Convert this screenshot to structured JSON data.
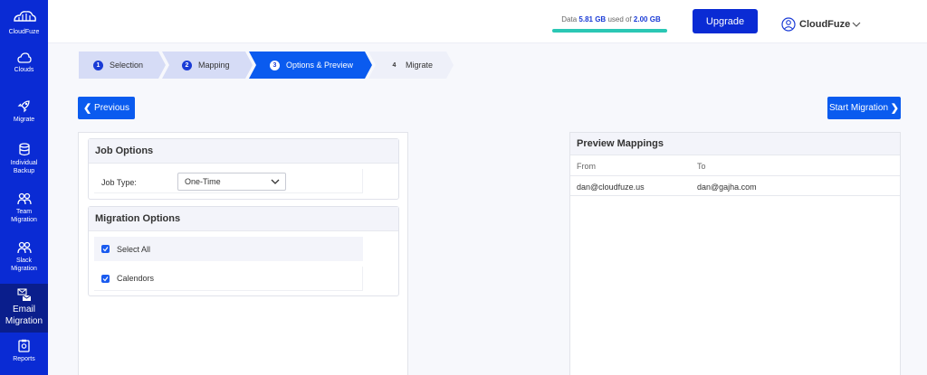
{
  "brand": {
    "name": "CloudFuze",
    "primary": "#0a2bd4",
    "active_nav": "#0a1e8c",
    "accent": "#0a5bef",
    "storage_fill": "#2ac7b4"
  },
  "sidebar": {
    "items": [
      {
        "label": "Clouds",
        "icon": "cloud-icon"
      },
      {
        "label": "Migrate",
        "icon": "rocket-icon"
      },
      {
        "label_line1": "Individual",
        "label_line2": "Backup",
        "icon": "database-icon"
      },
      {
        "label_line1": "Team",
        "label_line2": "Migration",
        "icon": "team-icon"
      },
      {
        "label_line1": "Slack",
        "label_line2": "Migration",
        "icon": "team-icon"
      },
      {
        "label_line1": "Email",
        "label_line2": "Migration",
        "icon": "email-icon",
        "active": true
      },
      {
        "label": "Reports",
        "icon": "clipboard-icon"
      }
    ]
  },
  "header": {
    "storage": {
      "prefix": "Data",
      "used": "5.81 GB",
      "middle": "used of",
      "total": "2.00 GB",
      "fill_percent": 100
    },
    "upgrade_label": "Upgrade",
    "account_name": "CloudFuze"
  },
  "stepper": {
    "steps": [
      {
        "num": "1",
        "label": "Selection",
        "state": "done"
      },
      {
        "num": "2",
        "label": "Mapping",
        "state": "done"
      },
      {
        "num": "3",
        "label": "Options & Preview",
        "state": "active"
      },
      {
        "num": "4",
        "label": "Migrate",
        "state": "pending"
      }
    ]
  },
  "actions": {
    "previous_label": "Previous",
    "start_label": "Start Migration"
  },
  "job_options": {
    "title": "Job Options",
    "job_type_label": "Job Type:",
    "job_type_value": "One-Time"
  },
  "migration_options": {
    "title": "Migration Options",
    "items": [
      {
        "label": "Select All",
        "checked": true
      },
      {
        "label": "Calendors",
        "checked": true
      }
    ]
  },
  "preview": {
    "title": "Preview Mappings",
    "columns": [
      "From",
      "To"
    ],
    "rows": [
      {
        "from": "dan@cloudfuze.us",
        "to": "dan@gajha.com"
      }
    ]
  }
}
